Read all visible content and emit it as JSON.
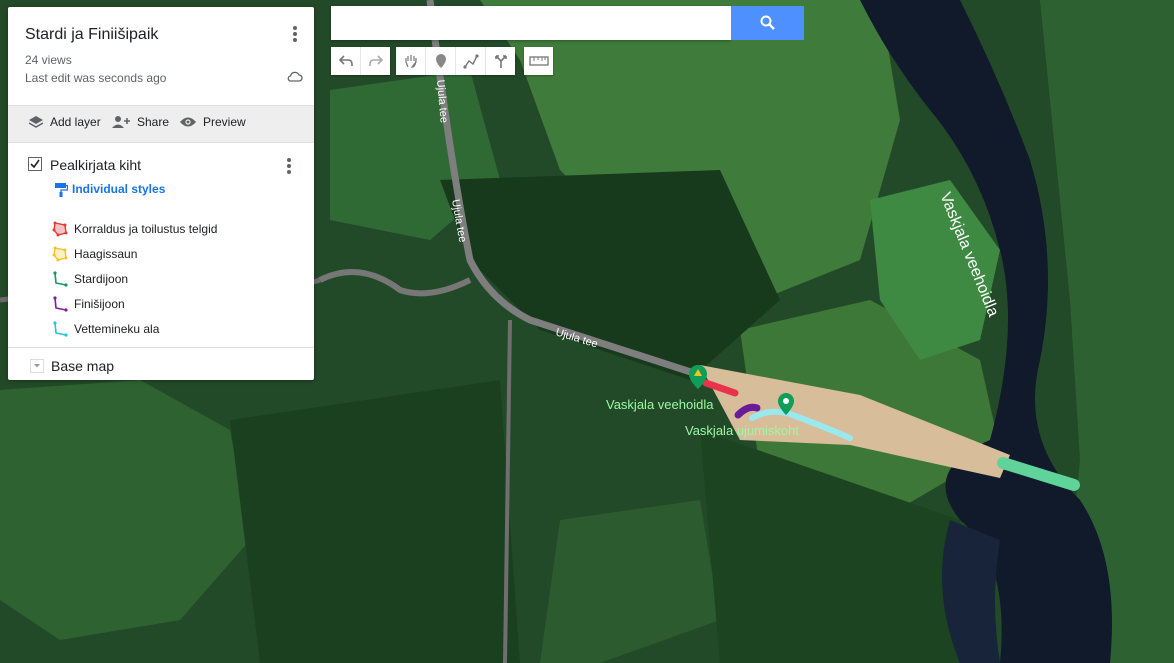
{
  "panel": {
    "title": "Stardi ja Finiišipaik",
    "views": "24 views",
    "last_edit": "Last edit was seconds ago",
    "actions": {
      "add_layer": "Add layer",
      "share": "Share",
      "preview": "Preview"
    },
    "layer": {
      "title": "Pealkirjata kiht",
      "checked": true,
      "style_link": "Individual styles",
      "features": [
        {
          "label": "Korraldus ja toilustus telgid",
          "icon": "polygon-icon",
          "color": "#e53935"
        },
        {
          "label": "Haagissaun",
          "icon": "polygon-icon",
          "color": "#f9c02b"
        },
        {
          "label": "Stardijoon",
          "icon": "line-icon",
          "color": "#0f9d58"
        },
        {
          "label": "Finišijoon",
          "icon": "line-icon",
          "color": "#7b1fa2"
        },
        {
          "label": "Vettemineku ala",
          "icon": "line-icon",
          "color": "#26c6da"
        }
      ]
    },
    "base_map": "Base map"
  },
  "search": {
    "placeholder": "",
    "value": ""
  },
  "toolbar": [
    "undo-icon",
    "redo-icon",
    "hand-icon",
    "marker-icon",
    "draw-line-icon",
    "directions-icon",
    "ruler-icon"
  ],
  "map": {
    "labels": {
      "road_1": "Ujula tee",
      "road_2": "Ujula tee",
      "road_3": "Ujula tee",
      "river": "Vaskjala veehoidla",
      "place_1": "Vaskjala veehoidla",
      "place_2": "Vaskjala ujumiskoht"
    },
    "colors": {
      "red_line": "#e8334a",
      "purple_line": "#6a1b9a",
      "cyan_line": "#8ee8f0",
      "green_line": "#5fd39a",
      "marker": "#0f9d58"
    }
  }
}
